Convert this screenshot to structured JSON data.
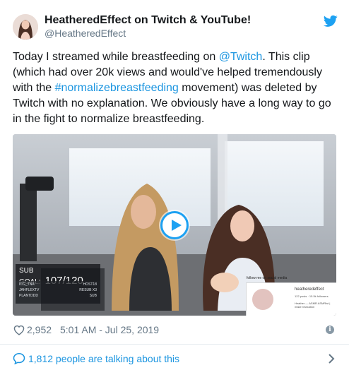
{
  "author": {
    "name": "HeatheredEffect on Twitch & YouTube!",
    "handle": "@HeatheredEffect"
  },
  "icons": {
    "avatar": "avatar-icon",
    "platform": "twitter-bird-icon",
    "play": "play-icon",
    "like": "heart-icon",
    "info": "info-icon",
    "conversation": "speech-bubble-icon",
    "more": "chevron-right-icon"
  },
  "tweet": {
    "part1": "Today I streamed while breastfeeding on ",
    "mention": "@Twitch",
    "part2": ". This clip (which had over 20k views and would've helped tremendously with the  ",
    "hashtag": "#normalizebreastfeeding",
    "part3": " movement) was deleted by Twitch with no explanation. We obviously have a long way to go in the fight to normalize breastfeeding."
  },
  "video_overlay": {
    "sub_goal_label": "SUB GOAL:",
    "sub_goal_value": "107/120",
    "rows": [
      {
        "name": "ICG_TNA",
        "note": "HOST18"
      },
      {
        "name": "JAHFLEXTV",
        "note": "RESUB X3"
      },
      {
        "name": "PLANTDDD",
        "note": "SUB"
      }
    ],
    "follow_text": "follow me on social media",
    "profile_name": "heatheredeffect",
    "profile_stats": "122 posts · 15.5k followers",
    "profile_bio": "Heather — ASMR\nASMRist | make relaxation"
  },
  "meta": {
    "likes": "2,952",
    "timestamp": "5:01 AM - Jul 25, 2019"
  },
  "footer": {
    "talking": "1,812 people are talking about this"
  },
  "colors": {
    "link": "#1b95e0",
    "twitter_blue": "#1da1f2",
    "muted": "#657786"
  }
}
